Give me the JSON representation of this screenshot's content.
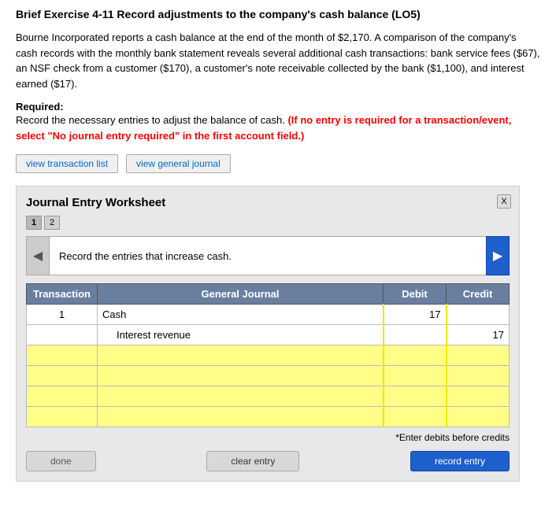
{
  "page": {
    "title": "Brief Exercise 4-11 Record adjustments to the company's cash balance (LO5)"
  },
  "intro": {
    "text": "Bourne Incorporated reports a cash balance at the end of the month of $2,170. A comparison of the company's cash records with the monthly bank statement reveals several additional cash transactions: bank service fees ($67), an NSF check from a customer ($170), a customer's note receivable collected by the bank ($1,100), and interest earned ($17)."
  },
  "required": {
    "label": "Required:",
    "text": "Record the necessary entries to adjust the balance of cash.",
    "red_text": "(If no entry is required for a transaction/event, select \"No journal entry required\" in the first account field.)"
  },
  "buttons": {
    "view_transaction": "view transaction list",
    "view_journal": "view general journal"
  },
  "worksheet": {
    "title": "Journal Entry Worksheet",
    "close_label": "X",
    "tabs": [
      {
        "label": "1",
        "active": true
      },
      {
        "label": "2",
        "active": false
      }
    ],
    "instruction": "Record the entries that increase cash.",
    "table": {
      "headers": {
        "transaction": "Transaction",
        "general_journal": "General Journal",
        "debit": "Debit",
        "credit": "Credit"
      },
      "rows": [
        {
          "transaction": "1",
          "account": "Cash",
          "debit": "17",
          "credit": "",
          "indent": false,
          "highlight": false
        },
        {
          "transaction": "",
          "account": "Interest revenue",
          "debit": "",
          "credit": "17",
          "indent": true,
          "highlight": false
        },
        {
          "transaction": "",
          "account": "",
          "debit": "",
          "credit": "",
          "indent": false,
          "highlight": true
        },
        {
          "transaction": "",
          "account": "",
          "debit": "",
          "credit": "",
          "indent": false,
          "highlight": true
        },
        {
          "transaction": "",
          "account": "",
          "debit": "",
          "credit": "",
          "indent": false,
          "highlight": true
        },
        {
          "transaction": "",
          "account": "",
          "debit": "",
          "credit": "",
          "indent": false,
          "highlight": true
        }
      ]
    },
    "enter_note": "*Enter debits before credits",
    "bottom_buttons": {
      "done": "done",
      "clear_entry": "clear entry",
      "record_entry": "record entry"
    }
  }
}
